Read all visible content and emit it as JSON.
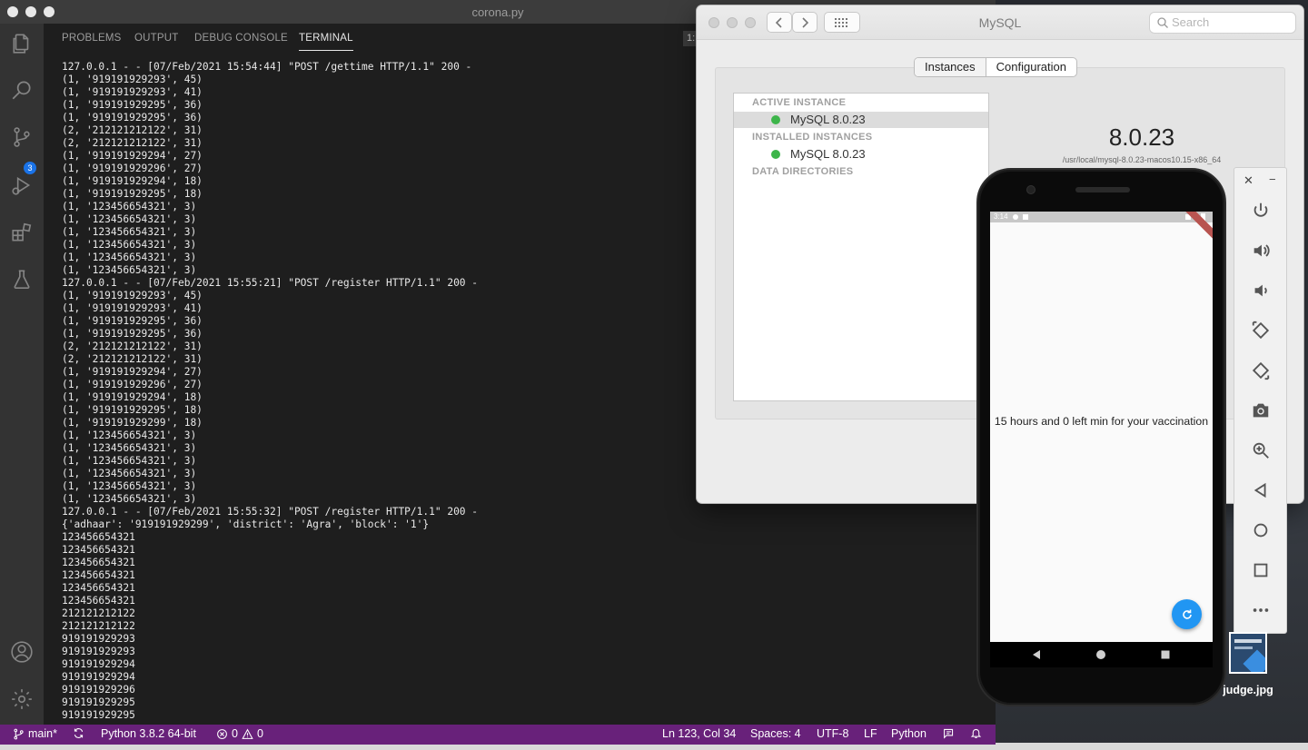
{
  "vscode": {
    "title": "corona.py",
    "scm_badge": "3",
    "panel_tabs": [
      "PROBLEMS",
      "OUTPUT",
      "DEBUG CONSOLE",
      "TERMINAL"
    ],
    "terminal_selector": "1:",
    "terminal_lines": [
      "127.0.0.1 - - [07/Feb/2021 15:54:44] \"POST /gettime HTTP/1.1\" 200 -",
      "(1, '919191929293', 45)",
      "(1, '919191929293', 41)",
      "(1, '919191929295', 36)",
      "(1, '919191929295', 36)",
      "(2, '212121212122', 31)",
      "(2, '212121212122', 31)",
      "(1, '919191929294', 27)",
      "(1, '919191929296', 27)",
      "(1, '919191929294', 18)",
      "(1, '919191929295', 18)",
      "(1, '123456654321', 3)",
      "(1, '123456654321', 3)",
      "(1, '123456654321', 3)",
      "(1, '123456654321', 3)",
      "(1, '123456654321', 3)",
      "(1, '123456654321', 3)",
      "127.0.0.1 - - [07/Feb/2021 15:55:21] \"POST /register HTTP/1.1\" 200 -",
      "(1, '919191929293', 45)",
      "(1, '919191929293', 41)",
      "(1, '919191929295', 36)",
      "(1, '919191929295', 36)",
      "(2, '212121212122', 31)",
      "(2, '212121212122', 31)",
      "(1, '919191929294', 27)",
      "(1, '919191929296', 27)",
      "(1, '919191929294', 18)",
      "(1, '919191929295', 18)",
      "(1, '919191929299', 18)",
      "(1, '123456654321', 3)",
      "(1, '123456654321', 3)",
      "(1, '123456654321', 3)",
      "(1, '123456654321', 3)",
      "(1, '123456654321', 3)",
      "(1, '123456654321', 3)",
      "127.0.0.1 - - [07/Feb/2021 15:55:32] \"POST /register HTTP/1.1\" 200 -",
      "{'adhaar': '919191929299', 'district': 'Agra', 'block': '1'}",
      "123456654321",
      "123456654321",
      "123456654321",
      "123456654321",
      "123456654321",
      "123456654321",
      "212121212122",
      "212121212122",
      "919191929293",
      "919191929293",
      "919191929294",
      "919191929294",
      "919191929296",
      "919191929295",
      "919191929295"
    ],
    "status": {
      "branch": "main*",
      "python": "Python 3.8.2 64-bit",
      "errors": "0",
      "warnings": "0",
      "position": "Ln 123, Col 34",
      "spaces": "Spaces: 4",
      "encoding": "UTF-8",
      "eol": "LF",
      "language": "Python"
    }
  },
  "mysql": {
    "title": "MySQL",
    "search_placeholder": "Search",
    "tabs": [
      "Instances",
      "Configuration"
    ],
    "active_instance_header": "ACTIVE INSTANCE",
    "active_instance": "MySQL 8.0.23",
    "installed_header": "INSTALLED INSTANCES",
    "installed_instance": "MySQL 8.0.23",
    "data_dirs_header": "DATA DIRECTORIES",
    "version": "8.0.23",
    "install_path": "/usr/local/mysql-8.0.23-macos10.15-x86_64"
  },
  "emulator": {
    "status_time": "3:14",
    "message": "15 hours and 0 left min for your vaccination"
  },
  "desktop": {
    "file_label": "judge.jpg"
  },
  "colors": {
    "statusbar": "#68217a",
    "fab": "#2196f3",
    "instance_dot": "#3db54a"
  }
}
